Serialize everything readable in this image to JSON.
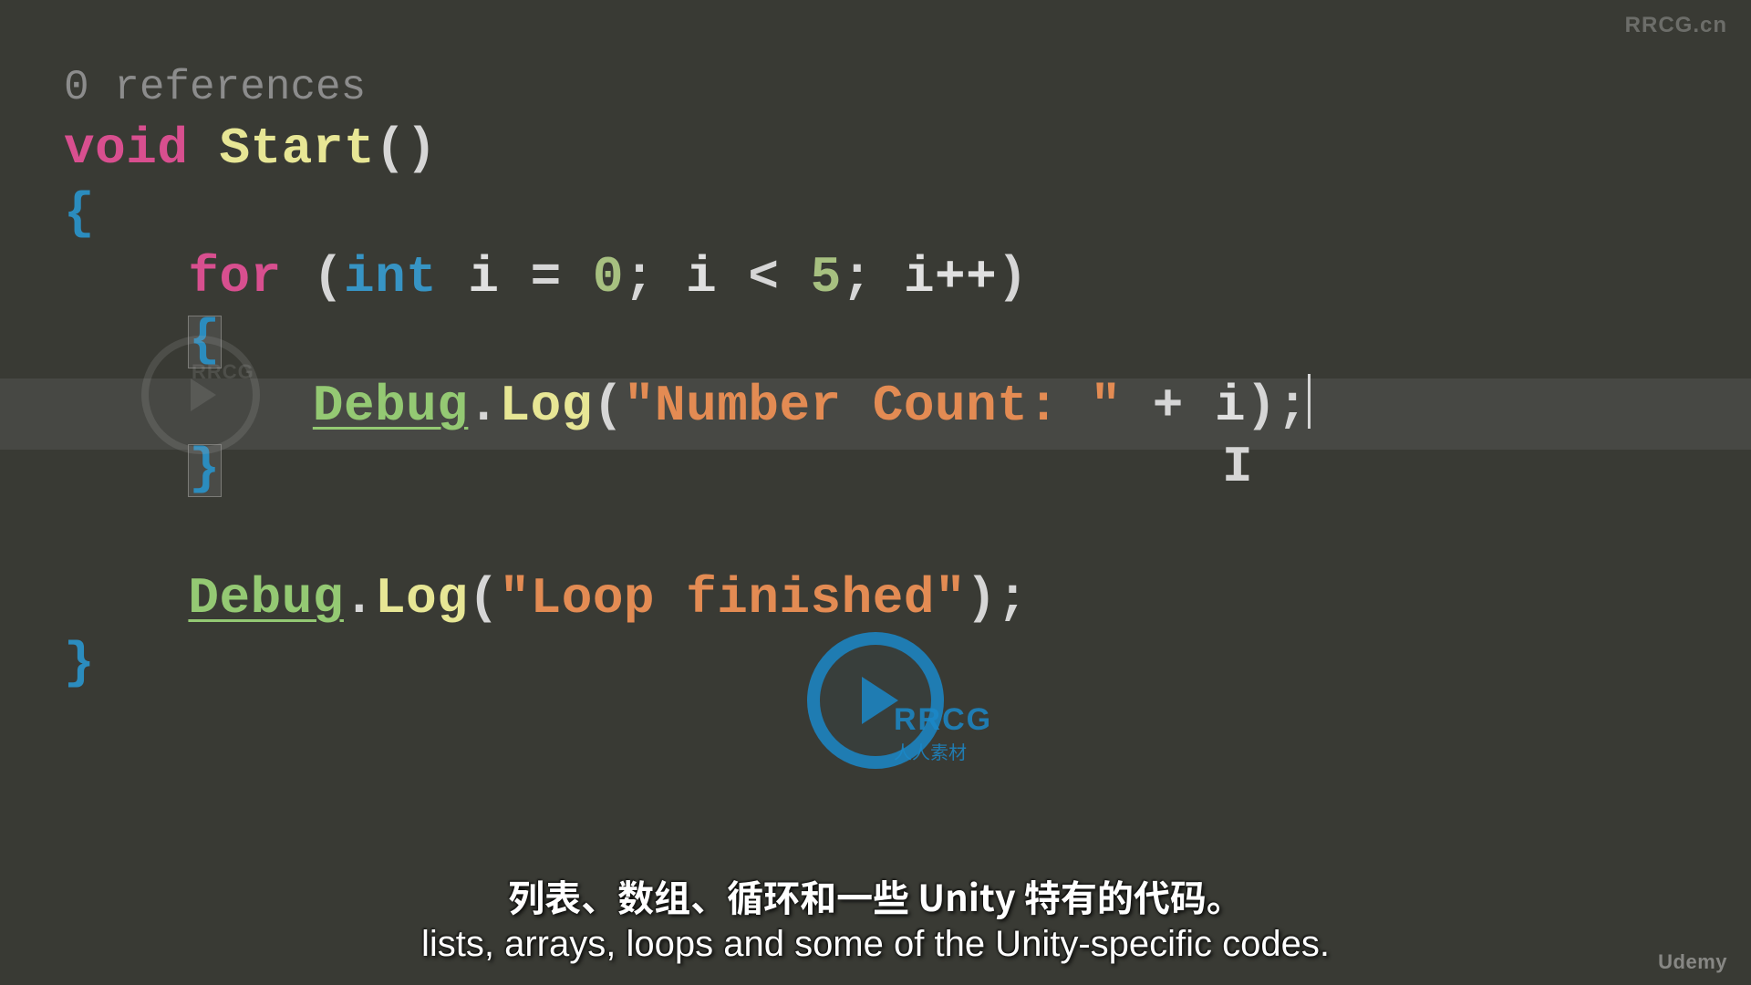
{
  "code": {
    "references_label": "0 references",
    "kw_void": "void",
    "fn_start": "Start",
    "open_paren": "(",
    "close_paren": ")",
    "open_brace": "{",
    "close_brace": "}",
    "kw_for": "for",
    "kw_int": "int",
    "var_i": "i",
    "assign": "=",
    "zero": "0",
    "semi": ";",
    "lt": "<",
    "five": "5",
    "incr": "i++",
    "cls_debug": "Debug",
    "dot": ".",
    "meth_log": "Log",
    "str_number_count": "\"Number Count: \"",
    "plus": "+",
    "str_loop_finished": "\"Loop finished\""
  },
  "subtitles": {
    "cn": "列表、数组、循环和一些 Unity 特有的代码。",
    "en": "lists, arrays, loops and some of the Unity-specific codes."
  },
  "watermarks": {
    "top_right": "RRCG.cn",
    "bottom_right": "Udemy",
    "center_big": "RRCG",
    "center_small": "人人素材",
    "faint_big": "RRCG"
  }
}
